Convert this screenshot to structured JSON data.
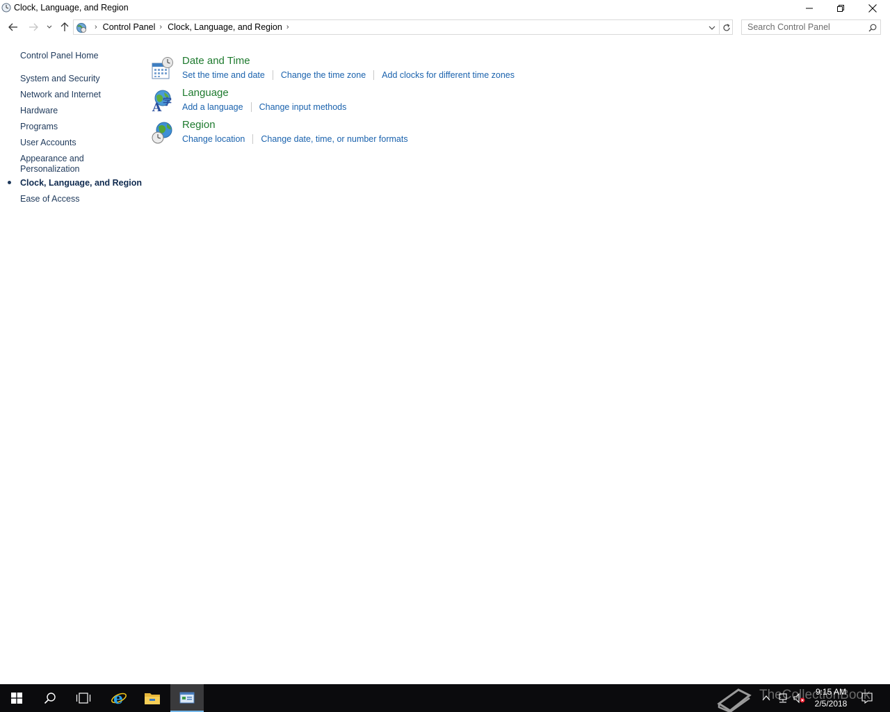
{
  "window": {
    "title": "Clock, Language, and Region"
  },
  "address_bar": {
    "breadcrumbs": [
      "Control Panel",
      "Clock, Language, and Region"
    ]
  },
  "search": {
    "placeholder": "Search Control Panel"
  },
  "sidebar": {
    "home": "Control Panel Home",
    "items": [
      {
        "label": "System and Security"
      },
      {
        "label": "Network and Internet"
      },
      {
        "label": "Hardware"
      },
      {
        "label": "Programs"
      },
      {
        "label": "User Accounts"
      },
      {
        "label": "Appearance and Personalization"
      },
      {
        "label": "Clock, Language, and Region",
        "current": true
      },
      {
        "label": "Ease of Access"
      }
    ]
  },
  "categories": [
    {
      "title": "Date and Time",
      "icon": "date-time-icon",
      "links": [
        "Set the time and date",
        "Change the time zone",
        "Add clocks for different time zones"
      ]
    },
    {
      "title": "Language",
      "icon": "language-icon",
      "links": [
        "Add a language",
        "Change input methods"
      ]
    },
    {
      "title": "Region",
      "icon": "region-icon",
      "links": [
        "Change location",
        "Change date, time, or number formats"
      ]
    }
  ],
  "taskbar": {
    "watermark": "TheCollectionBook",
    "clock_time": "9:15 AM",
    "clock_date": "2/5/2018"
  },
  "colors": {
    "link": "#1a62ad",
    "category_title": "#1e7a2e",
    "sidebar_link": "#1e395b",
    "taskbar": "#0b0b0d"
  }
}
